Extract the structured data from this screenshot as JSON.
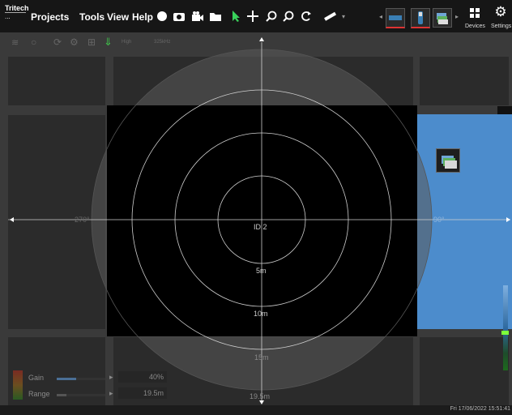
{
  "app": {
    "logo_title": "Tritech",
    "logo_sub": "..."
  },
  "menu": {
    "projects": "Projects",
    "tools": "Tools",
    "view": "View",
    "help": "Help"
  },
  "toolbar_icons": [
    "record-circle-icon",
    "camera-icon",
    "video-camera-icon",
    "folder-icon",
    "select-pointer-icon",
    "pan-move-icon",
    "zoom-in-icon",
    "zoom-out-icon",
    "rotate-icon",
    "measure-ruler-icon"
  ],
  "devices": {
    "label": "Devices"
  },
  "settings": {
    "label": "Settings"
  },
  "secondary_toolbar": {
    "label_high": "High",
    "label_freq": "325kHz"
  },
  "sonar": {
    "id_label": "ID 2",
    "ranges": [
      "5m",
      "10m",
      "15m",
      "19.5m"
    ],
    "bearing_left": "270°",
    "bearing_right": "90°"
  },
  "controls": {
    "gain_label": "Gain",
    "gain_value": "40%",
    "gain_level": 0.4,
    "range_label": "Range",
    "range_value": "19.5m"
  },
  "status": {
    "clock": "Fri 17/06/2022 15:51:41"
  },
  "colors": {
    "accent_blue": "#4c8ccc",
    "toolbar_green": "#39d35b"
  }
}
